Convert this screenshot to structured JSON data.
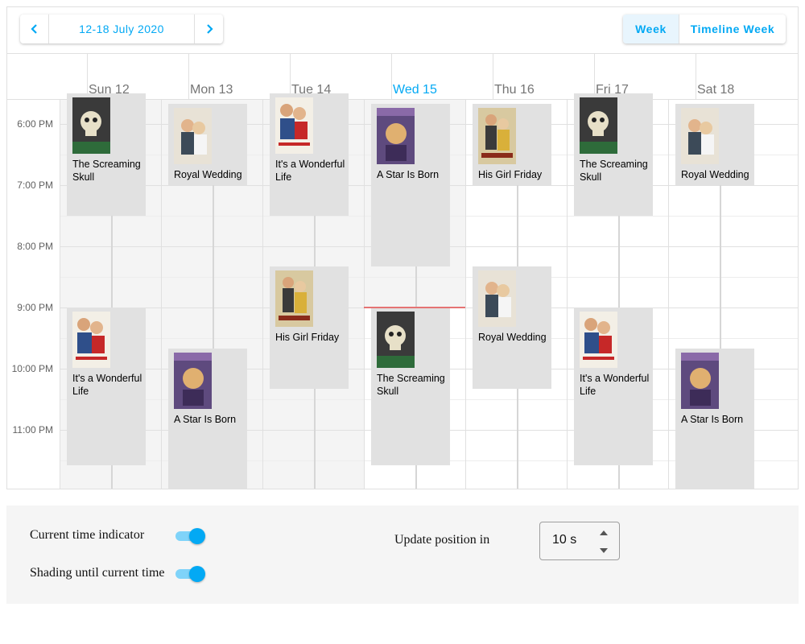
{
  "toolbar": {
    "date_range": "12-18 July 2020",
    "views": [
      {
        "label": "Week",
        "selected": true
      },
      {
        "label": "Timeline Week",
        "selected": false
      }
    ]
  },
  "days": [
    {
      "label": "Sun 12",
      "today": false
    },
    {
      "label": "Mon 13",
      "today": false
    },
    {
      "label": "Tue 14",
      "today": false
    },
    {
      "label": "Wed 15",
      "today": true
    },
    {
      "label": "Thu 16",
      "today": false
    },
    {
      "label": "Fri 17",
      "today": false
    },
    {
      "label": "Sat 18",
      "today": false
    }
  ],
  "time_labels": [
    "6:00 PM",
    "7:00 PM",
    "8:00 PM",
    "9:00 PM",
    "10:00 PM",
    "11:00 PM"
  ],
  "appointments": [
    {
      "title": "The Screaming Skull",
      "day": 0,
      "start": "5:30 PM",
      "end": "7:30 PM"
    },
    {
      "title": "It's a Wonderful Life",
      "day": 0,
      "start": "9:00 PM",
      "end": "11:35 PM"
    },
    {
      "title": "Royal Wedding",
      "day": 1,
      "start": "5:40 PM",
      "end": "7:00 PM"
    },
    {
      "title": "A Star Is Born",
      "day": 1,
      "start": "9:40 PM",
      "end": "12:00 AM"
    },
    {
      "title": "It's a Wonderful Life",
      "day": 2,
      "start": "5:30 PM",
      "end": "7:30 PM"
    },
    {
      "title": "His Girl Friday",
      "day": 2,
      "start": "8:20 PM",
      "end": "10:20 PM"
    },
    {
      "title": "A Star Is Born",
      "day": 3,
      "start": "5:40 PM",
      "end": "8:20 PM"
    },
    {
      "title": "The Screaming Skull",
      "day": 3,
      "start": "9:00 PM",
      "end": "11:35 PM"
    },
    {
      "title": "His Girl Friday",
      "day": 4,
      "start": "5:40 PM",
      "end": "7:00 PM"
    },
    {
      "title": "Royal Wedding",
      "day": 4,
      "start": "8:20 PM",
      "end": "10:20 PM"
    },
    {
      "title": "The Screaming Skull",
      "day": 5,
      "start": "5:30 PM",
      "end": "7:30 PM"
    },
    {
      "title": "It's a Wonderful Life",
      "day": 5,
      "start": "9:00 PM",
      "end": "11:35 PM"
    },
    {
      "title": "Royal Wedding",
      "day": 6,
      "start": "5:40 PM",
      "end": "7:00 PM"
    },
    {
      "title": "A Star Is Born",
      "day": 6,
      "start": "9:40 PM",
      "end": "12:00 AM"
    }
  ],
  "current_time": {
    "day": 3,
    "time": "9:00 PM"
  },
  "options": {
    "current_time_indicator": {
      "label": "Current time indicator",
      "enabled": true
    },
    "shading_until_current_time": {
      "label": "Shading until current time",
      "enabled": true
    },
    "update_position": {
      "label": "Update position in",
      "value": "10 s"
    }
  },
  "colors": {
    "accent": "#03a9f4",
    "appointment": "#e1e1e1",
    "current_time_line": "#e57373",
    "shading": "#f4f4f4"
  }
}
